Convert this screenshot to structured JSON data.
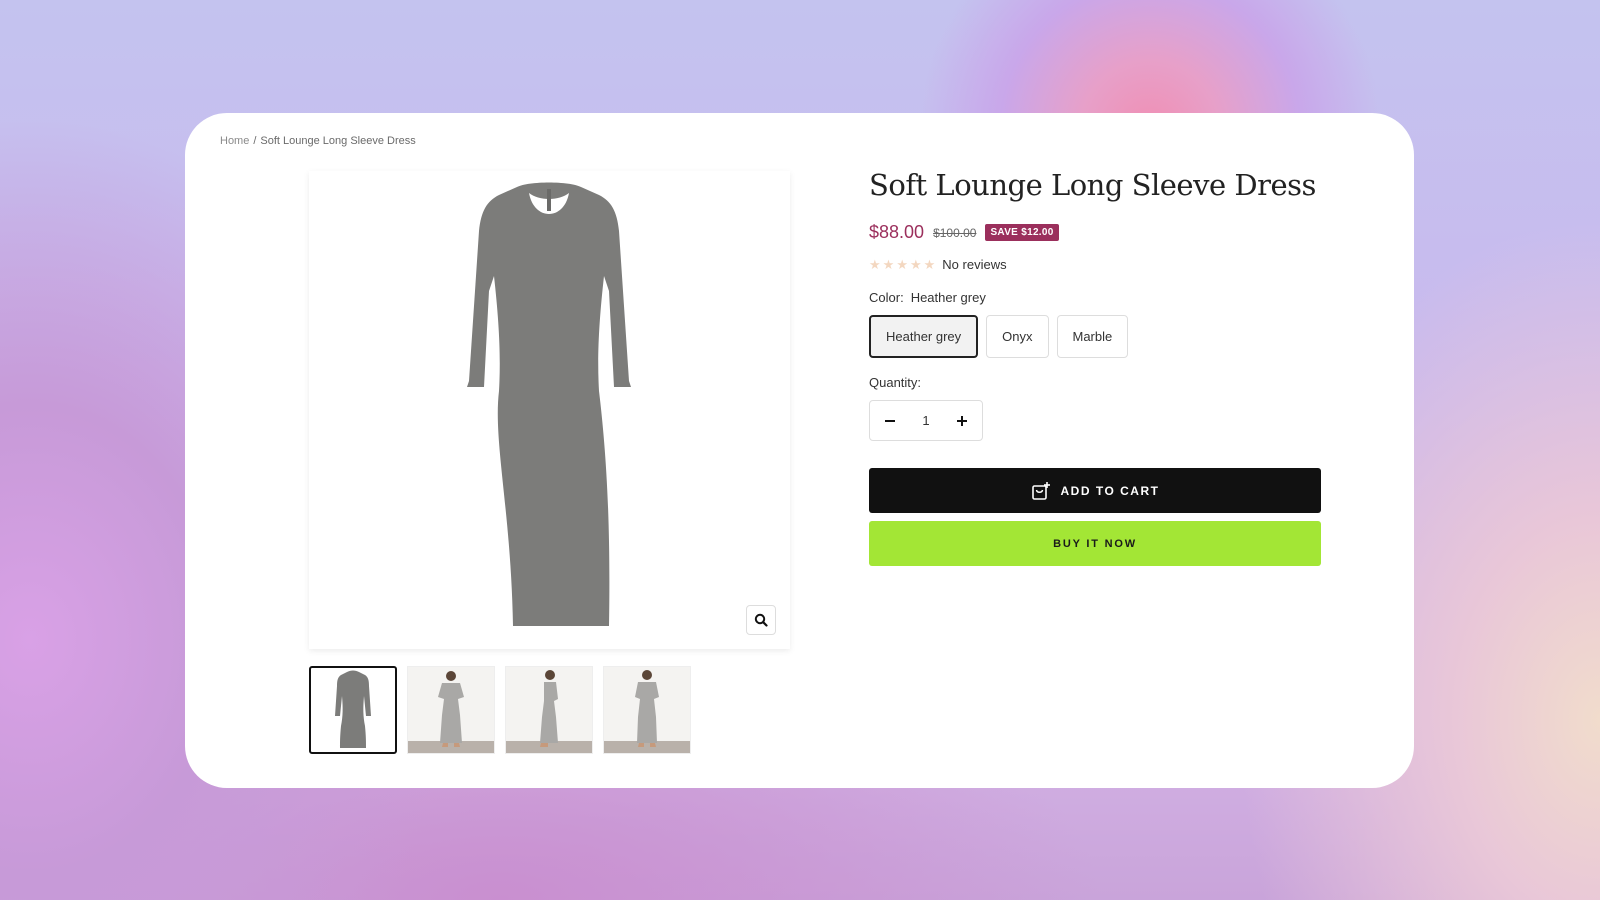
{
  "breadcrumb": {
    "home": "Home",
    "separator": "/",
    "current": "Soft Lounge Long Sleeve Dress"
  },
  "product": {
    "title": "Soft Lounge Long Sleeve Dress",
    "price": "$88.00",
    "compare_price": "$100.00",
    "save_badge": "SAVE $12.00",
    "rating_stars": 5,
    "reviews_text": "No reviews",
    "color_label": "Color:",
    "color_value": "Heather grey",
    "colors": [
      "Heather grey",
      "Onyx",
      "Marble"
    ],
    "selected_color": "Heather grey",
    "quantity_label": "Quantity:",
    "quantity": "1",
    "add_to_cart_label": "ADD TO CART",
    "buy_now_label": "BUY IT NOW"
  },
  "gallery": {
    "thumbnails": 4,
    "active_thumbnail": 1
  },
  "colors": {
    "price": "#9b2f5c",
    "badge": "#9b2f5c",
    "add_to_cart_bg": "#111111",
    "buy_now_bg": "#a3e635",
    "dress": "#7c7c7a"
  },
  "icons": {
    "zoom": "search-icon",
    "cart": "cart-add-icon",
    "minus": "minus-icon",
    "plus": "plus-icon"
  }
}
